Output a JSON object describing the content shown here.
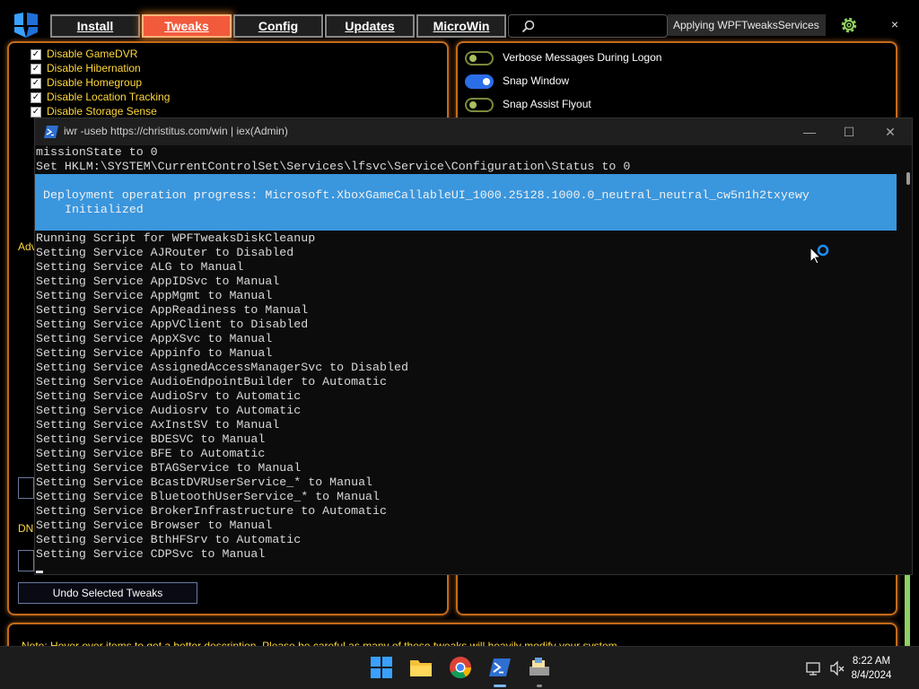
{
  "topbar": {
    "tabs": [
      {
        "label": "Install",
        "active": false
      },
      {
        "label": "Tweaks",
        "active": true
      },
      {
        "label": "Config",
        "active": false
      },
      {
        "label": "Updates",
        "active": false
      },
      {
        "label": "MicroWin",
        "active": false
      }
    ],
    "search_icon": "search-icon",
    "status_tooltip": "Applying WPFTweaksServices",
    "settings_icon": "gear-icon",
    "close_label": "×"
  },
  "colors": {
    "accent_orange": "#c46a1a",
    "active_tab": "#f25a3c",
    "item_text": "#ffd83a",
    "progress_bg": "#3a96dd",
    "toggle_on": "#2a6ee8"
  },
  "tweaks_left": {
    "items": [
      {
        "label": "Disable GameDVR",
        "checked": true
      },
      {
        "label": "Disable Hibernation",
        "checked": true
      },
      {
        "label": "Disable Homegroup",
        "checked": true
      },
      {
        "label": "Disable Location Tracking",
        "checked": true
      },
      {
        "label": "Disable Storage Sense",
        "checked": true
      }
    ],
    "advanced_label_fragment": "Adv",
    "dns_label_fragment": "DN",
    "undo_button": "Undo Selected Tweaks"
  },
  "tweaks_right": {
    "toggles": [
      {
        "label": "Verbose Messages During Logon",
        "on": false
      },
      {
        "label": "Snap Window",
        "on": true
      },
      {
        "label": "Snap Assist Flyout",
        "on": false
      }
    ]
  },
  "note": "Note: Hover over items to get a better description. Please be careful as many of these tweaks will heavily modify your system.",
  "terminal": {
    "title": "iwr -useb https://christitus.com/win | iex(Admin)",
    "minimize": "—",
    "maximize": "☐",
    "close": "✕",
    "lines_before": [
      "missionState to 0",
      "Set HKLM:\\SYSTEM\\CurrentControlSet\\Services\\lfsvc\\Service\\Configuration\\Status to 0"
    ],
    "progress_line1": "Deployment operation progress: Microsoft.XboxGameCallableUI_1000.25128.1000.0_neutral_neutral_cw5n1h2txyewy",
    "progress_line2": "Initialized",
    "lines_after": [
      "Running Script for WPFTweaksDiskCleanup",
      "Setting Service AJRouter to Disabled",
      "Setting Service ALG to Manual",
      "Setting Service AppIDSvc to Manual",
      "Setting Service AppMgmt to Manual",
      "Setting Service AppReadiness to Manual",
      "Setting Service AppVClient to Disabled",
      "Setting Service AppXSvc to Manual",
      "Setting Service Appinfo to Manual",
      "Setting Service AssignedAccessManagerSvc to Disabled",
      "Setting Service AudioEndpointBuilder to Automatic",
      "Setting Service AudioSrv to Automatic",
      "Setting Service Audiosrv to Automatic",
      "Setting Service AxInstSV to Manual",
      "Setting Service BDESVC to Manual",
      "Setting Service BFE to Automatic",
      "Setting Service BTAGService to Manual",
      "Setting Service BcastDVRUserService_* to Manual",
      "Setting Service BluetoothUserService_* to Manual",
      "Setting Service BrokerInfrastructure to Automatic",
      "Setting Service Browser to Manual",
      "Setting Service BthHFSrv to Automatic",
      "Setting Service CDPSvc to Manual"
    ]
  },
  "taskbar": {
    "apps": [
      "windows-start-icon",
      "file-explorer-icon",
      "chrome-icon",
      "powershell-icon",
      "installer-icon"
    ],
    "time": "8:22 AM",
    "date": "8/4/2024"
  }
}
